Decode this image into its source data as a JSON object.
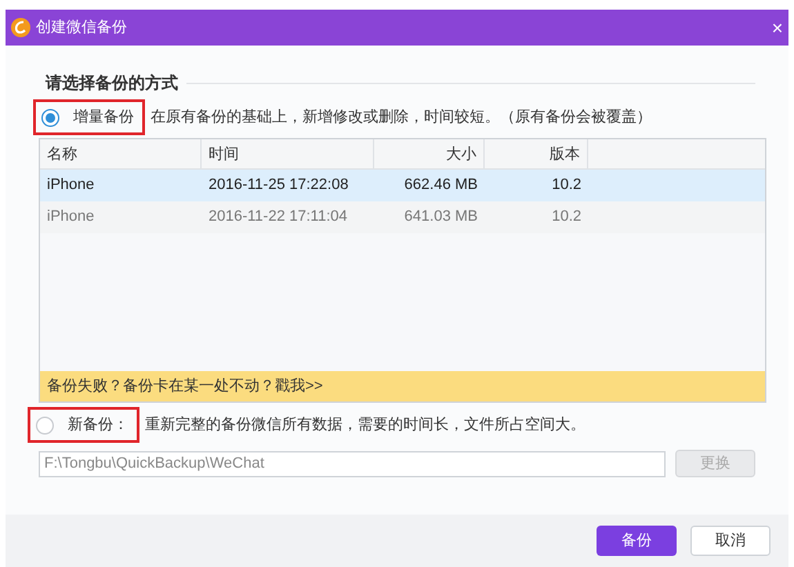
{
  "window": {
    "title": "创建微信备份",
    "close": "×"
  },
  "section_title": "请选择备份的方式",
  "options": [
    {
      "label": "增量备份",
      "description": "在原有备份的基础上，新增修改或删除，时间较短。（原有备份会被覆盖）",
      "selected": true,
      "highlighted": true
    },
    {
      "label": "新备份：",
      "description": "重新完整的备份微信所有数据，需要的时间长，文件所占空间大。",
      "selected": false,
      "highlighted": true
    }
  ],
  "table": {
    "columns": [
      "名称",
      "时间",
      "大小",
      "版本"
    ],
    "rows": [
      {
        "cells": [
          "iPhone",
          "2016-11-25 17:22:08",
          "662.46 MB",
          "10.2"
        ],
        "selected": true
      },
      {
        "cells": [
          "iPhone",
          "2016-11-22 17:11:04",
          "641.03 MB",
          "10.2"
        ],
        "selected": false
      }
    ]
  },
  "help_bar": "备份失败？备份卡在某一处不动？戳我>>",
  "path_field": {
    "value": "F:\\Tongbu\\QuickBackup\\WeChat",
    "disabled": true
  },
  "change_button": {
    "label": "更换",
    "disabled": true
  },
  "buttons": [
    {
      "label": "备份",
      "kind": "primary"
    },
    {
      "label": "取消",
      "kind": "secondary"
    }
  ]
}
